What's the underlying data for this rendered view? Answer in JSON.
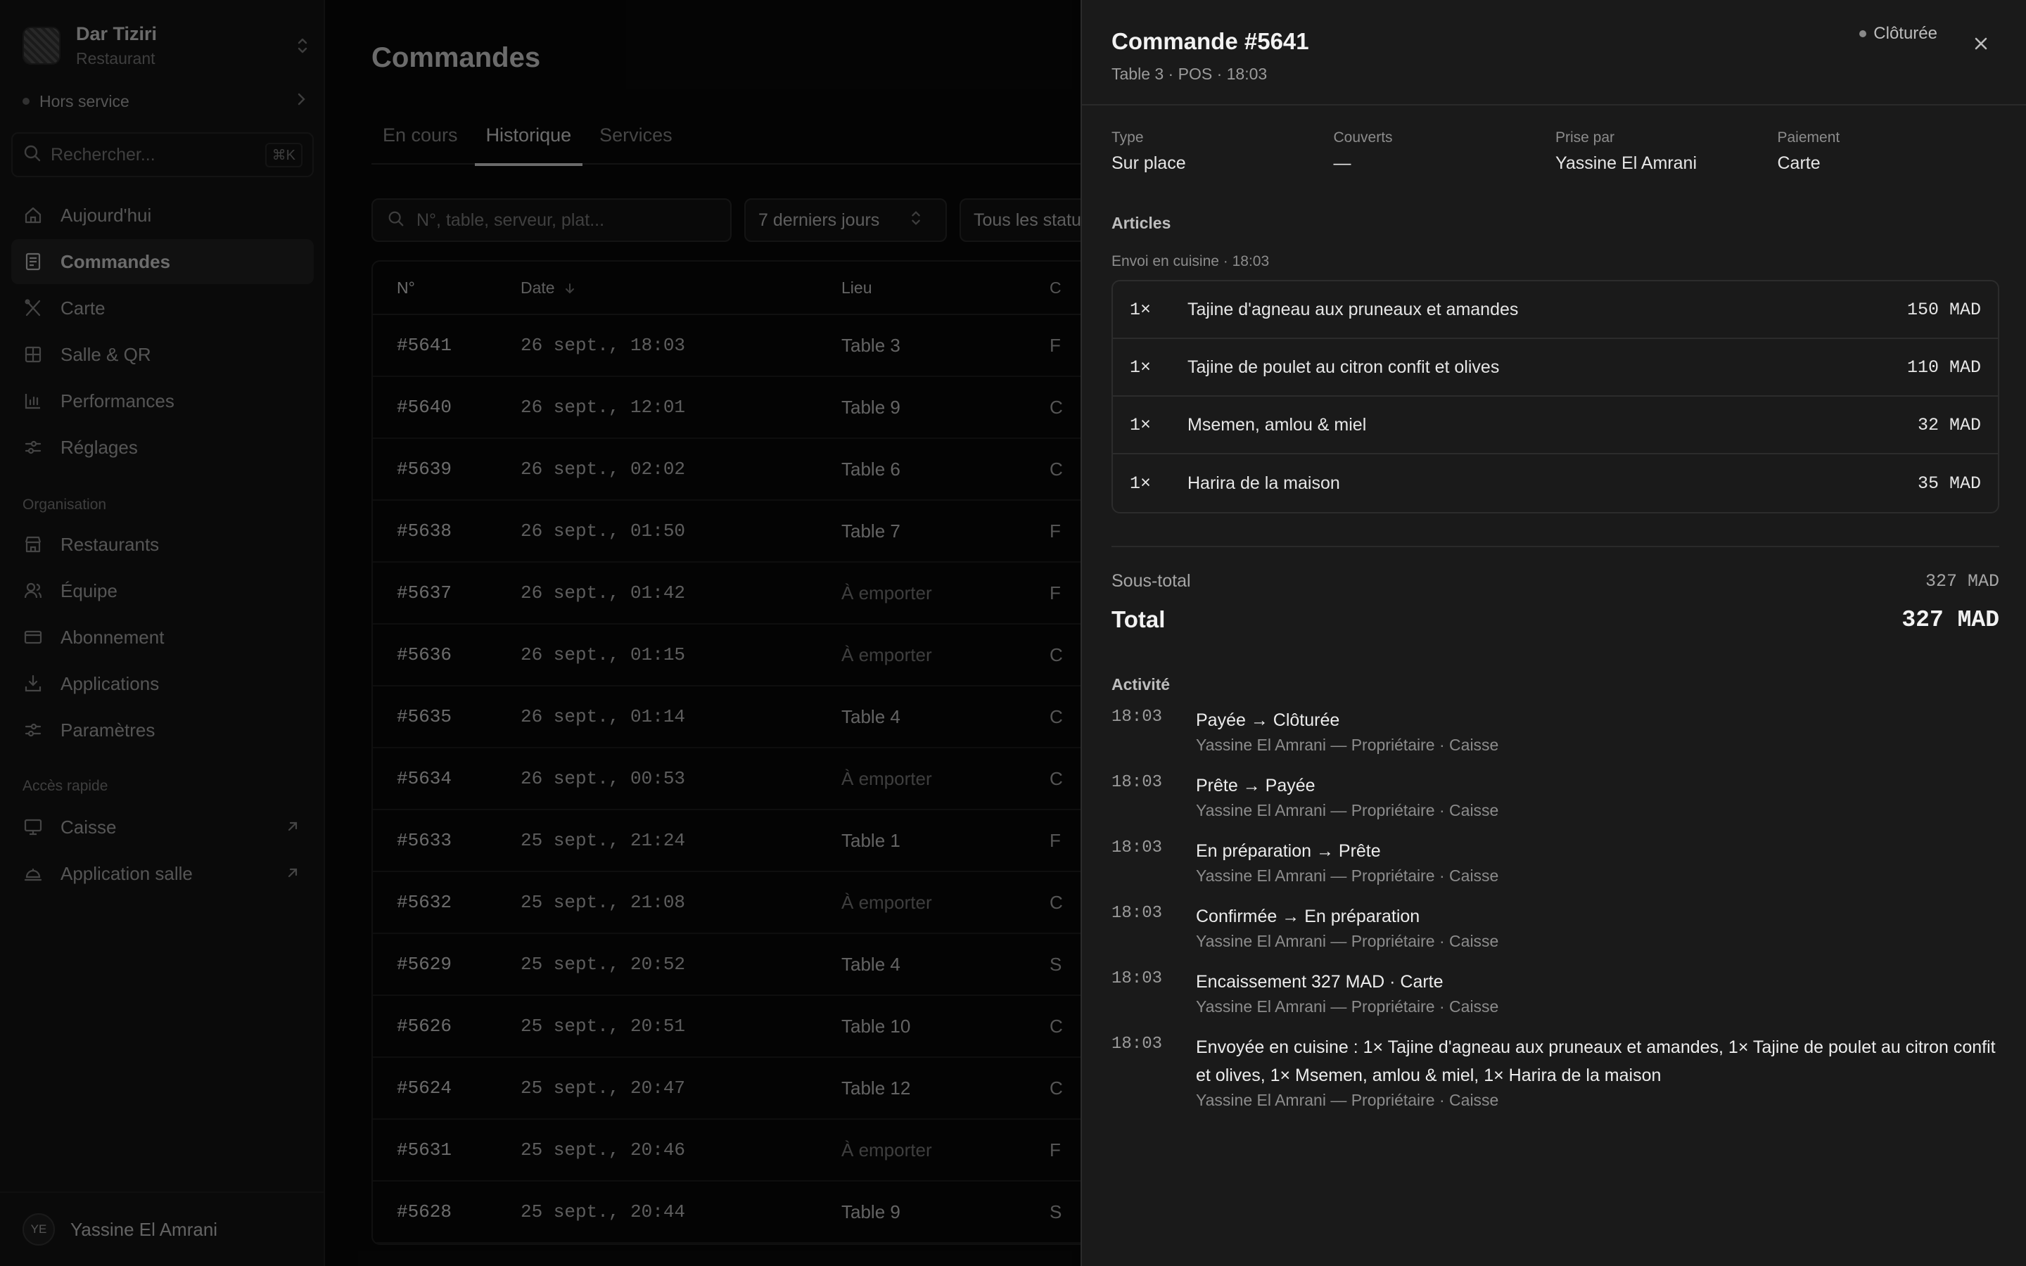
{
  "workspace": {
    "name": "Dar Tiziri",
    "type": "Restaurant",
    "status": "Hors service"
  },
  "search": {
    "placeholder": "Rechercher...",
    "shortcut": "⌘K"
  },
  "nav": [
    {
      "label": "Aujourd'hui",
      "icon": "home-icon"
    },
    {
      "label": "Commandes",
      "icon": "receipt-icon",
      "active": true
    },
    {
      "label": "Carte",
      "icon": "utensils-icon"
    },
    {
      "label": "Salle & QR",
      "icon": "grid-icon"
    },
    {
      "label": "Performances",
      "icon": "bar-chart-icon"
    },
    {
      "label": "Réglages",
      "icon": "sliders-icon"
    }
  ],
  "org": {
    "label": "Organisation",
    "items": [
      {
        "label": "Restaurants",
        "icon": "store-icon"
      },
      {
        "label": "Équipe",
        "icon": "users-icon"
      },
      {
        "label": "Abonnement",
        "icon": "card-icon"
      },
      {
        "label": "Applications",
        "icon": "download-icon"
      },
      {
        "label": "Paramètres",
        "icon": "sliders-icon"
      }
    ]
  },
  "quick": {
    "label": "Accès rapide",
    "items": [
      {
        "label": "Caisse",
        "icon": "monitor-icon"
      },
      {
        "label": "Application salle",
        "icon": "cloche-icon"
      }
    ]
  },
  "user": {
    "initials": "YE",
    "name": "Yassine El Amrani"
  },
  "page": {
    "title": "Commandes",
    "tabs": [
      "En cours",
      "Historique",
      "Services"
    ],
    "filter_placeholder": "N°, table, serveur, plat...",
    "range": "7 derniers jours",
    "status_filter": "Tous les statuts"
  },
  "orders_table": {
    "headers": [
      "N°",
      "Date",
      "Lieu",
      "C"
    ],
    "rows": [
      {
        "num": "#5641",
        "date": "26 sept., 18:03",
        "place": "Table 3",
        "ch": "F"
      },
      {
        "num": "#5640",
        "date": "26 sept., 12:01",
        "place": "Table 9",
        "ch": "C"
      },
      {
        "num": "#5639",
        "date": "26 sept., 02:02",
        "place": "Table 6",
        "ch": "C"
      },
      {
        "num": "#5638",
        "date": "26 sept., 01:50",
        "place": "Table 7",
        "ch": "F"
      },
      {
        "num": "#5637",
        "date": "26 sept., 01:42",
        "place": "À emporter",
        "ch": "F"
      },
      {
        "num": "#5636",
        "date": "26 sept., 01:15",
        "place": "À emporter",
        "ch": "C"
      },
      {
        "num": "#5635",
        "date": "26 sept., 01:14",
        "place": "Table 4",
        "ch": "C"
      },
      {
        "num": "#5634",
        "date": "26 sept., 00:53",
        "place": "À emporter",
        "ch": "C"
      },
      {
        "num": "#5633",
        "date": "25 sept., 21:24",
        "place": "Table 1",
        "ch": "F"
      },
      {
        "num": "#5632",
        "date": "25 sept., 21:08",
        "place": "À emporter",
        "ch": "C"
      },
      {
        "num": "#5629",
        "date": "25 sept., 20:52",
        "place": "Table 4",
        "ch": "S"
      },
      {
        "num": "#5626",
        "date": "25 sept., 20:51",
        "place": "Table 10",
        "ch": "C"
      },
      {
        "num": "#5624",
        "date": "25 sept., 20:47",
        "place": "Table 12",
        "ch": "C"
      },
      {
        "num": "#5631",
        "date": "25 sept., 20:46",
        "place": "À emporter",
        "ch": "F"
      },
      {
        "num": "#5628",
        "date": "25 sept., 20:44",
        "place": "Table 9",
        "ch": "S"
      }
    ]
  },
  "order": {
    "title": "Commande #5641",
    "subtitle": "Table 3 · POS · 18:03",
    "status": "Clôturée",
    "meta": [
      {
        "label": "Type",
        "value": "Sur place"
      },
      {
        "label": "Couverts",
        "value": "—"
      },
      {
        "label": "Prise par",
        "value": "Yassine El Amrani"
      },
      {
        "label": "Paiement",
        "value": "Carte"
      }
    ],
    "articles_label": "Articles",
    "kitchen_note": "Envoi en cuisine · 18:03",
    "items": [
      {
        "qty": "1×",
        "name": "Tajine d'agneau aux pruneaux et amandes",
        "price": "150 MAD"
      },
      {
        "qty": "1×",
        "name": "Tajine de poulet au citron confit et olives",
        "price": "110 MAD"
      },
      {
        "qty": "1×",
        "name": "Msemen, amlou & miel",
        "price": "32 MAD"
      },
      {
        "qty": "1×",
        "name": "Harira de la maison",
        "price": "35 MAD"
      }
    ],
    "subtotal_label": "Sous-total",
    "subtotal": "327 MAD",
    "total_label": "Total",
    "total": "327 MAD",
    "activity_label": "Activité",
    "activity": [
      {
        "time": "18:03",
        "event": "Payée → Clôturée",
        "by": "Yassine El Amrani — Propriétaire · Caisse"
      },
      {
        "time": "18:03",
        "event": "Prête → Payée",
        "by": "Yassine El Amrani — Propriétaire · Caisse"
      },
      {
        "time": "18:03",
        "event": "En préparation → Prête",
        "by": "Yassine El Amrani — Propriétaire · Caisse"
      },
      {
        "time": "18:03",
        "event": "Confirmée → En préparation",
        "by": "Yassine El Amrani — Propriétaire · Caisse"
      },
      {
        "time": "18:03",
        "event": "Encaissement 327 MAD · Carte",
        "by": "Yassine El Amrani — Propriétaire · Caisse"
      },
      {
        "time": "18:03",
        "event": "Envoyée en cuisine : 1× Tajine d'agneau aux pruneaux et amandes, 1× Tajine de poulet au citron confit et olives, 1× Msemen, amlou & miel, 1× Harira de la maison",
        "by": "Yassine El Amrani — Propriétaire · Caisse"
      }
    ]
  }
}
